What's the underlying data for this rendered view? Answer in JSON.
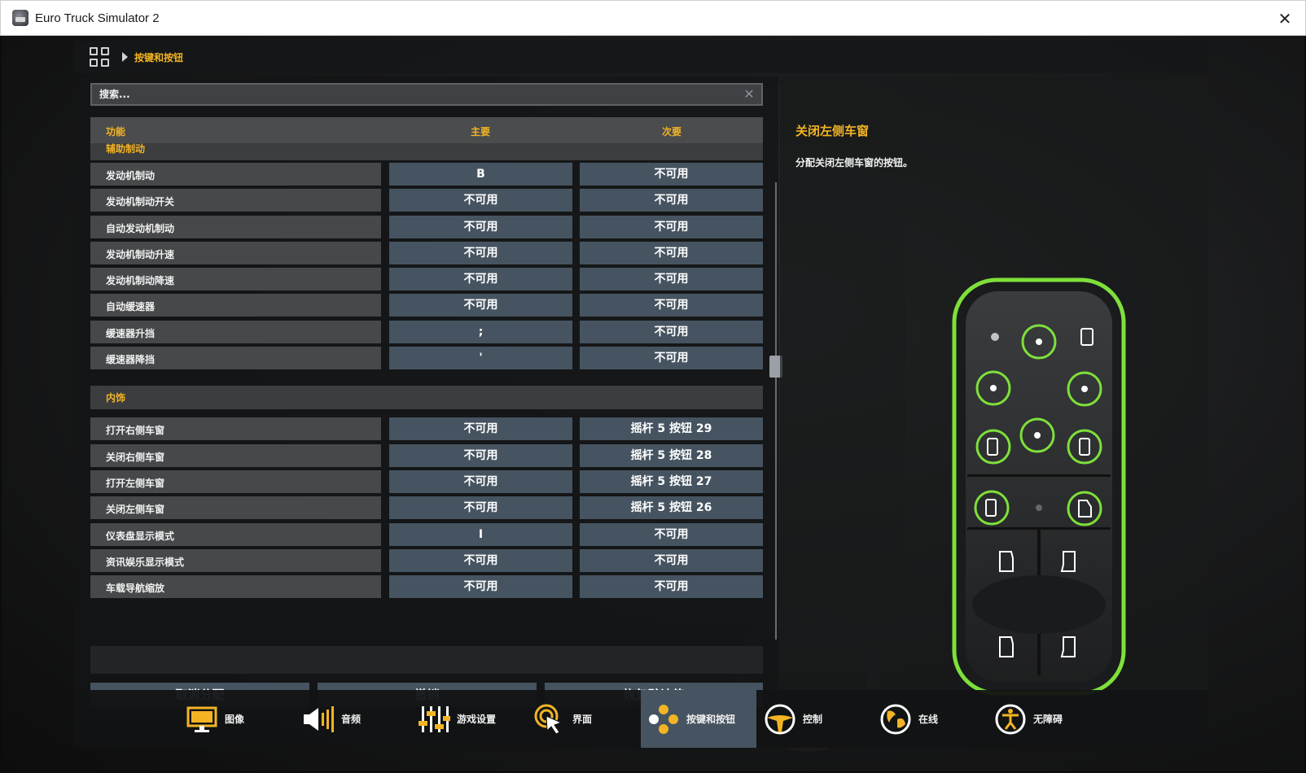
{
  "window": {
    "title": "Euro Truck Simulator 2"
  },
  "breadcrumb": {
    "current": "按键和按钮"
  },
  "search": {
    "placeholder": "搜索..."
  },
  "columns": {
    "function": "功能",
    "primary": "主要",
    "secondary": "次要"
  },
  "sections": [
    {
      "label": "辅助制动",
      "rows": [
        {
          "name": "发动机制动",
          "primary": "B",
          "secondary": "不可用"
        },
        {
          "name": "发动机制动开关",
          "primary": "不可用",
          "secondary": "不可用"
        },
        {
          "name": "自动发动机制动",
          "primary": "不可用",
          "secondary": "不可用"
        },
        {
          "name": "发动机制动升速",
          "primary": "不可用",
          "secondary": "不可用"
        },
        {
          "name": "发动机制动降速",
          "primary": "不可用",
          "secondary": "不可用"
        },
        {
          "name": "自动缓速器",
          "primary": "不可用",
          "secondary": "不可用"
        },
        {
          "name": "缓速器升挡",
          "primary": ";",
          "secondary": "不可用"
        },
        {
          "name": "缓速器降挡",
          "primary": "'",
          "secondary": "不可用"
        }
      ]
    },
    {
      "label": "内饰",
      "rows": [
        {
          "name": "打开右侧车窗",
          "primary": "不可用",
          "secondary": "摇杆 5 按钮 29"
        },
        {
          "name": "关闭右侧车窗",
          "primary": "不可用",
          "secondary": "摇杆 5 按钮 28"
        },
        {
          "name": "打开左侧车窗",
          "primary": "不可用",
          "secondary": "摇杆 5 按钮 27"
        },
        {
          "name": "关闭左侧车窗",
          "primary": "不可用",
          "secondary": "摇杆 5 按钮 26"
        },
        {
          "name": "仪表盘显示模式",
          "primary": "I",
          "secondary": "不可用"
        },
        {
          "name": "资讯娱乐显示模式",
          "primary": "不可用",
          "secondary": "不可用"
        },
        {
          "name": "车载导航缩放",
          "primary": "不可用",
          "secondary": "不可用"
        }
      ]
    }
  ],
  "buttons": {
    "unassign": "取消分配",
    "undo": "撤销",
    "reset": "恢复默认值"
  },
  "description": {
    "title": "关闭左侧车窗",
    "text": "分配关闭左侧车窗的按钮。"
  },
  "nav": [
    {
      "label": "图像",
      "icon": "monitor-icon",
      "active": false
    },
    {
      "label": "音频",
      "icon": "speaker-icon",
      "active": false
    },
    {
      "label": "游戏设置",
      "icon": "sliders-icon",
      "active": false
    },
    {
      "label": "界面",
      "icon": "cursor-icon",
      "active": false
    },
    {
      "label": "按键和按钮",
      "icon": "buttons-icon",
      "active": true
    },
    {
      "label": "控制",
      "icon": "steering-wheel-icon",
      "active": false
    },
    {
      "label": "在线",
      "icon": "globe-icon",
      "active": false
    },
    {
      "label": "无障碍",
      "icon": "accessibility-icon",
      "active": false
    }
  ],
  "colors": {
    "accent": "#f3b424",
    "key_cell": "#465461",
    "name_cell": "#46484a",
    "highlight": "#7ee03a"
  }
}
